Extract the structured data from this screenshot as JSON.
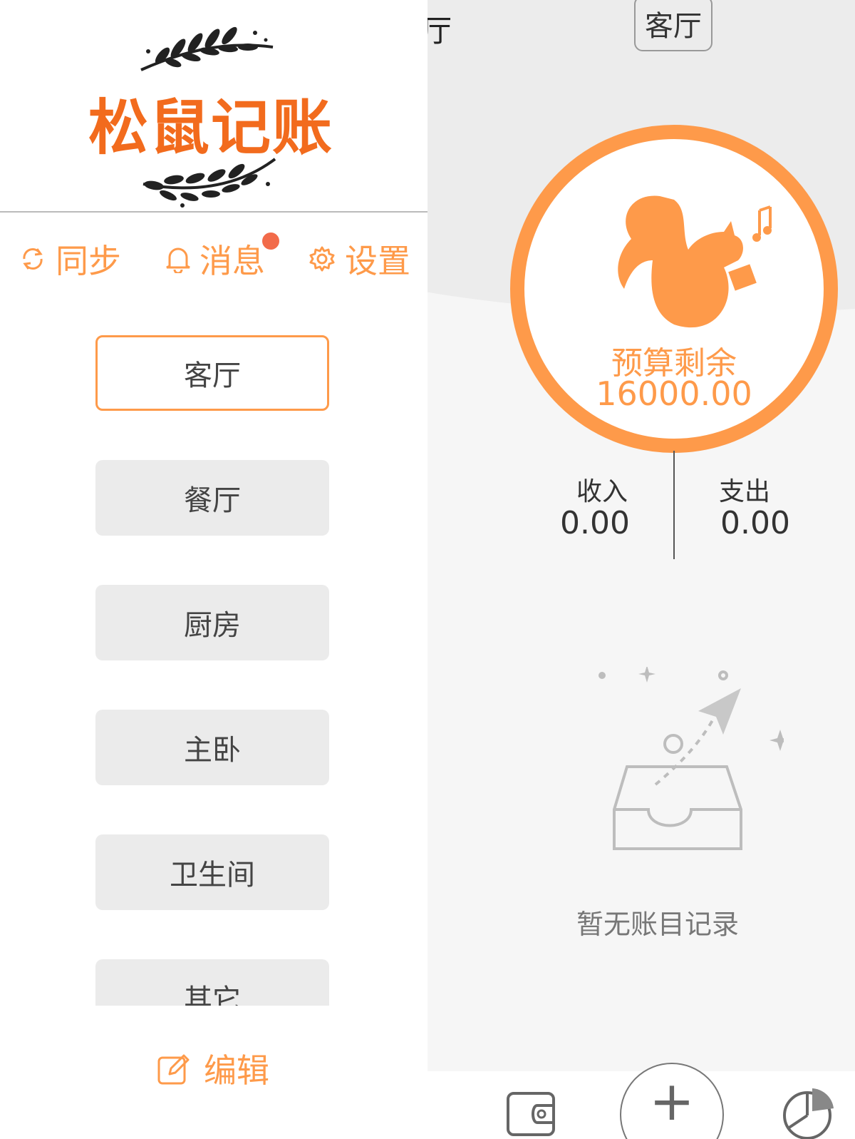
{
  "main": {
    "title_partial": "厅",
    "title": "客厅",
    "budget": {
      "label": "预算剩余",
      "value": "16000.00"
    },
    "income": {
      "label": "收入",
      "value": "0.00"
    },
    "expense": {
      "label": "支出",
      "value": "0.00"
    },
    "empty_text": "暂无账目记录",
    "bottom_bar": {
      "add_label": "+"
    }
  },
  "drawer": {
    "app_name": "松鼠记账",
    "actions": {
      "sync": "同步",
      "messages": "消息",
      "settings": "设置"
    },
    "rooms": [
      "客厅",
      "餐厅",
      "厨房",
      "主卧",
      "卫生间",
      "其它"
    ],
    "active_room_index": 0,
    "edit_label": "编辑"
  },
  "colors": {
    "accent": "#fe9a4a",
    "brand": "#f26b1d",
    "badge": "#f26b4a",
    "room_bg": "#ebebeb"
  }
}
